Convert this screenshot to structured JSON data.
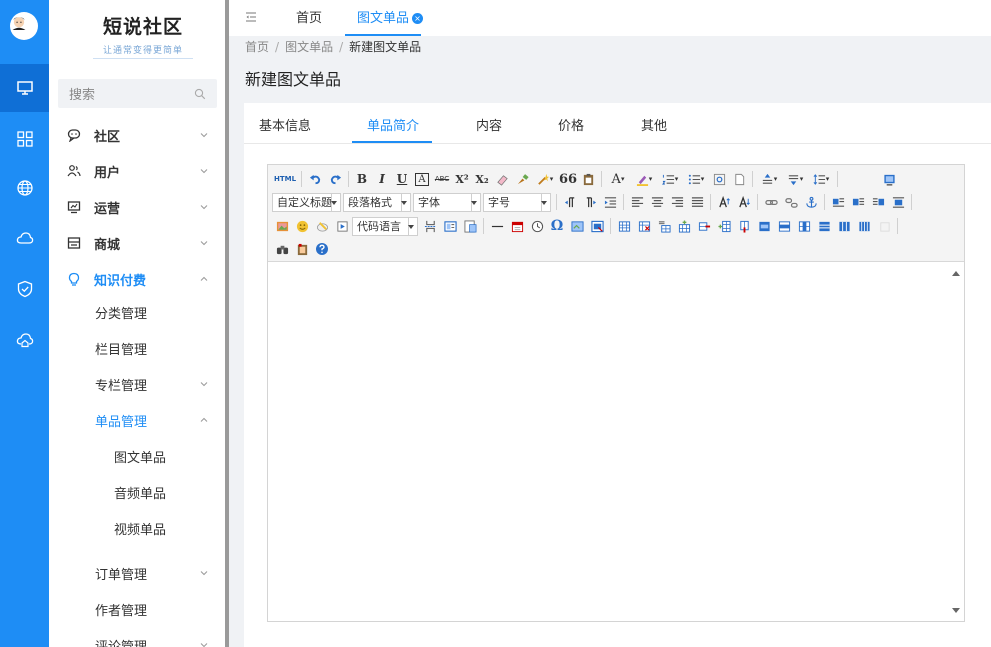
{
  "colors": {
    "accent": "#1e8df5",
    "rail_bg": "#1e8df5",
    "rail_active": "#0f6fd6"
  },
  "rail": {
    "items": [
      "desktop-icon",
      "grid-icon",
      "globe-icon",
      "cloud-icon",
      "shield-check-icon",
      "cloud-home-icon"
    ]
  },
  "logo": {
    "name": "短说社区",
    "slogan": "让通常变得更简单"
  },
  "search": {
    "placeholder": "搜索"
  },
  "menu": {
    "community": "社区",
    "users": "用户",
    "operations": "运营",
    "mall": "商城",
    "knowledge": "知识付费",
    "category_mgmt": "分类管理",
    "column_mgmt": "栏目管理",
    "special_mgmt": "专栏管理",
    "single_mgmt": "单品管理",
    "image_single": "图文单品",
    "audio_single": "音频单品",
    "video_single": "视频单品",
    "order_mgmt": "订单管理",
    "author_mgmt": "作者管理",
    "comment_mgmt": "评论管理"
  },
  "tabs": {
    "home": "首页",
    "current": "图文单品",
    "close": "×"
  },
  "breadcrumb": {
    "home": "首页",
    "parent": "图文单品",
    "current": "新建图文单品",
    "sep": "/"
  },
  "page_title": "新建图文单品",
  "subtabs": {
    "basic": "基本信息",
    "intro": "单品简介",
    "content": "内容",
    "price": "价格",
    "other": "其他"
  },
  "editor": {
    "custom_heading": "自定义标题",
    "paragraph_format": "段落格式",
    "font_family": "字体",
    "font_size": "字号",
    "code_language": "代码语言",
    "html_label": "HTML",
    "bold": "B",
    "italic": "I",
    "underline": "U",
    "boxed_a": "A",
    "strike": "ABC",
    "sup": "X²",
    "sub": "X₂",
    "quote": "66",
    "font_color": "A",
    "omega": "Ω"
  }
}
